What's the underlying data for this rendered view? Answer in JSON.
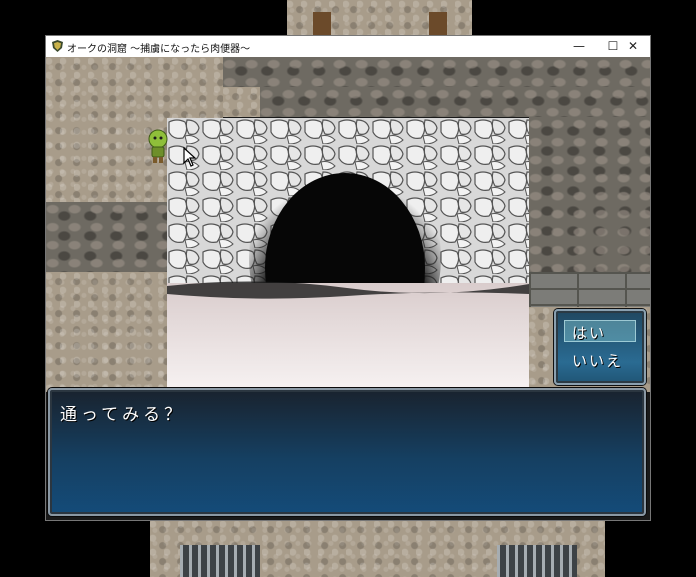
{
  "window": {
    "title": "オークの洞窟 〜捕虜になったら肉便器〜",
    "minimize_glyph": "—",
    "maximize_glyph": "☐",
    "close_glyph": "✕"
  },
  "choices": {
    "selected_index": 0,
    "yes_label": "はい",
    "no_label": "いいえ"
  },
  "message": {
    "text": "通ってみる？"
  },
  "icons": {
    "app": "shield-icon",
    "cursor": "mouse-pointer-icon",
    "character": "orc-sprite"
  },
  "colors": {
    "window_blue": "#2a6b92",
    "stone_floor": "#a89c8a",
    "cave_dark": "#0b0b0b"
  }
}
